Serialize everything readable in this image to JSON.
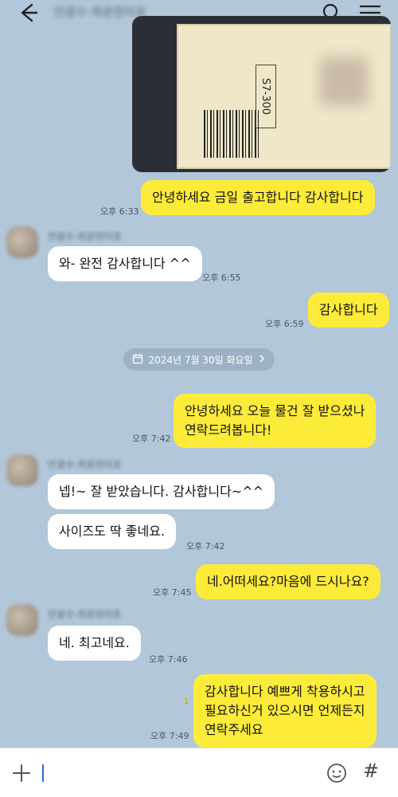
{
  "header": {
    "title": "안광수-최윤현미포"
  },
  "date_divider": "2024년 7월 30일 화요일",
  "photo": {
    "code": "S7-300"
  },
  "messages": [
    {
      "text": "안녕하세요 금일 출고합니다 감사합니다",
      "time": "오후 6:33"
    },
    {
      "text": "와- 완전 감사합니다 ^^",
      "time": "오후 6:55"
    },
    {
      "text": "감사합니다",
      "time": "오후 6:59"
    },
    {
      "line1": "안녕하세요 오늘 물건 잘 받으셨나",
      "line2": "연락드려봅니다!",
      "time": "오후 7:42"
    },
    {
      "text": "넵!~ 잘 받았습니다. 감사합니다~^^"
    },
    {
      "text": "사이즈도 딱 좋네요.",
      "time": "오후 7:42"
    },
    {
      "text": "네.어떠세요?마음에 드시나요?",
      "time": "오후 7:45"
    },
    {
      "text": "네. 최고네요.",
      "time": "오후 7:46"
    },
    {
      "line1": "감사합니다 예쁘게 착용하시고",
      "line2": "필요하신거 있으시면 언제든지",
      "line3": "연락주세요",
      "time": "오후 7:49",
      "unread": "1"
    }
  ],
  "sender_name": "안광수-최윤현미포",
  "icons": [
    "back-arrow-icon",
    "search-icon",
    "menu-icon",
    "calendar-icon",
    "chevron-right-icon",
    "plus-icon",
    "emoji-icon",
    "hash-icon"
  ]
}
